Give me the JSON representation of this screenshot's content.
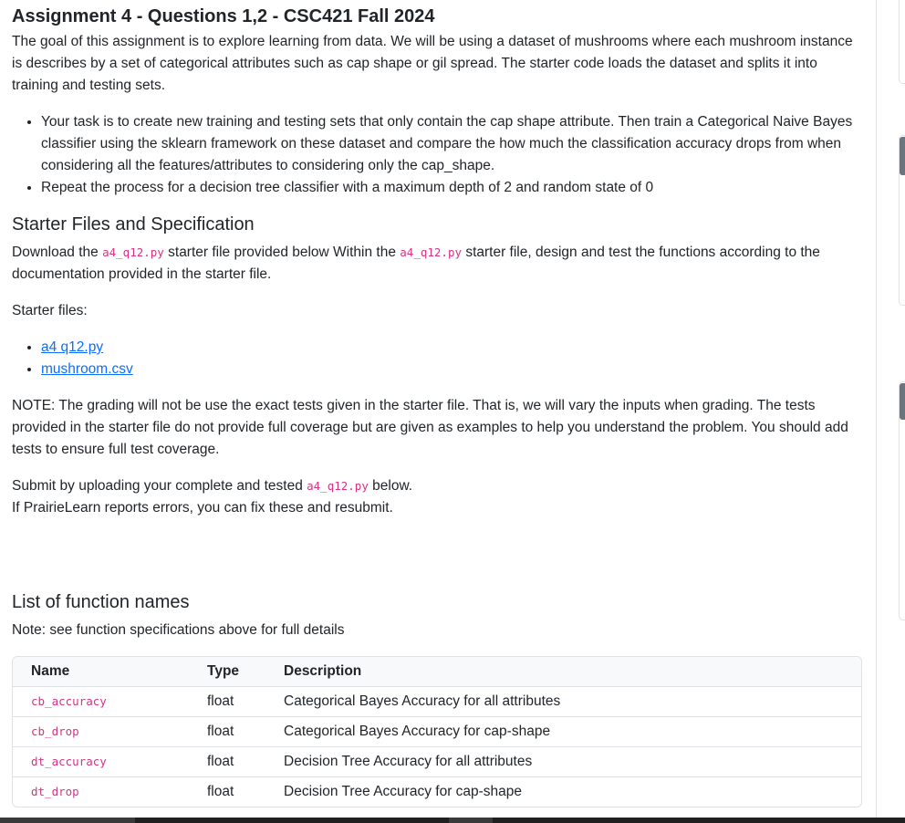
{
  "assignment": {
    "title": "Assignment 4 - Questions 1,2 - CSC421 Fall 2024",
    "intro": "The goal of this assignment is to explore learning from data. We will be using a dataset of mushrooms where each mushroom instance is describes by a set of categorical attributes such as cap shape or gil spread. The starter code loads the dataset and splits it into training and testing sets.",
    "tasks": [
      "Your task is to create new training and testing sets that only contain the cap shape attribute. Then train a Categorical Naive Bayes classifier using the sklearn framework on these dataset and compare the how much the classification accuracy drops from when considering all the features/attributes to considering only the cap_shape.",
      "Repeat the process for a decision tree classifier with a maximum depth of 2 and random state of 0"
    ]
  },
  "starter": {
    "heading": "Starter Files and Specification",
    "download_prefix": "Download the ",
    "filename": "a4_q12.py",
    "download_middle": " starter file provided below Within the ",
    "download_suffix": " starter file, design and test the functions according to the documentation provided in the starter file.",
    "files_label": "Starter files:",
    "files": [
      "a4 q12.py",
      "mushroom.csv"
    ],
    "note": "NOTE: The grading will not be use the exact tests given in the starter file. That is, we will vary the inputs when grading. The tests provided in the starter file do not provide full coverage but are given as examples to help you understand the problem. You should add tests to ensure full test coverage.",
    "submit_prefix": "Submit by uploading your complete and tested ",
    "submit_suffix": " below.",
    "errors": "If PrairieLearn reports errors, you can fix these and resubmit."
  },
  "functions": {
    "heading": "List of function names",
    "note": "Note: see function specifications above for full details",
    "columns": [
      "Name",
      "Type",
      "Description"
    ],
    "rows": [
      {
        "name": "cb_accuracy",
        "type": "float",
        "description": "Categorical Bayes Accuracy for all attributes"
      },
      {
        "name": "cb_drop",
        "type": "float",
        "description": "Categorical Bayes Accuracy for cap-shape"
      },
      {
        "name": "dt_accuracy",
        "type": "float",
        "description": "Decision Tree Accuracy for all attributes"
      },
      {
        "name": "dt_drop",
        "type": "float",
        "description": "Decision Tree Accuracy for cap-shape"
      }
    ]
  },
  "colors": {
    "code": "#d63384",
    "link": "#0d6efd",
    "border": "#dee2e6"
  }
}
